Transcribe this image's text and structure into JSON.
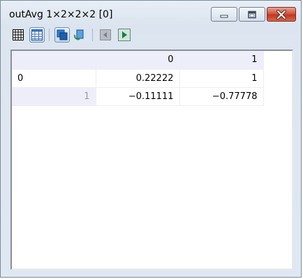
{
  "window": {
    "title": "outAvg 1×2×2×2 [0]"
  },
  "titlebar_buttons": {
    "minimize": "minimize-icon",
    "maximize": "maximize-icon",
    "close": "close-icon"
  },
  "toolbar": {
    "buttons": [
      {
        "icon": "grid-view-icon",
        "selected": false
      },
      {
        "icon": "table-view-icon",
        "selected": true
      },
      {
        "icon": "copy-icon",
        "selected": true
      },
      {
        "icon": "refresh-icon",
        "selected": false
      },
      {
        "icon": "previous-icon",
        "selected": false
      },
      {
        "icon": "play-icon",
        "selected": false
      }
    ]
  },
  "table": {
    "column_headers": [
      "0",
      "1"
    ],
    "rows": [
      {
        "header": "0",
        "values": [
          "0.22222",
          "1"
        ]
      },
      {
        "header": "1",
        "values": [
          "−0.11111",
          "−0.77778"
        ]
      }
    ]
  },
  "colors": {
    "header_bg": "#eeeefb",
    "frame_bg": "#dde6f0",
    "close_red": "#c3361f"
  }
}
